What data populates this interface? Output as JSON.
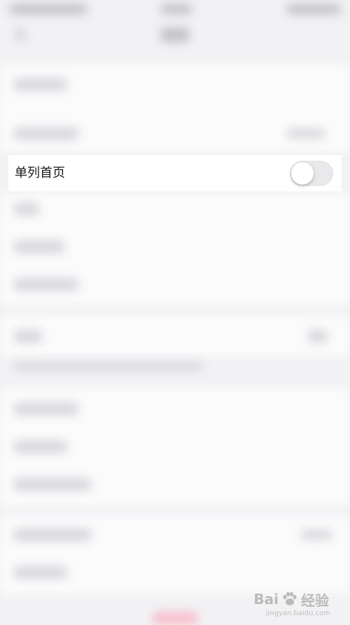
{
  "settings": {
    "single_column_home": {
      "label": "单列首页",
      "enabled": false
    }
  },
  "watermark": {
    "brand": "Bai",
    "brand_tail": "经验",
    "sub": "jingyan.baidu.com"
  },
  "colors": {
    "background": "#f2f2f4",
    "card": "#fbfbfc",
    "toggle_off": "#e9e9eb",
    "accent_pink": "#f7c3d0"
  }
}
